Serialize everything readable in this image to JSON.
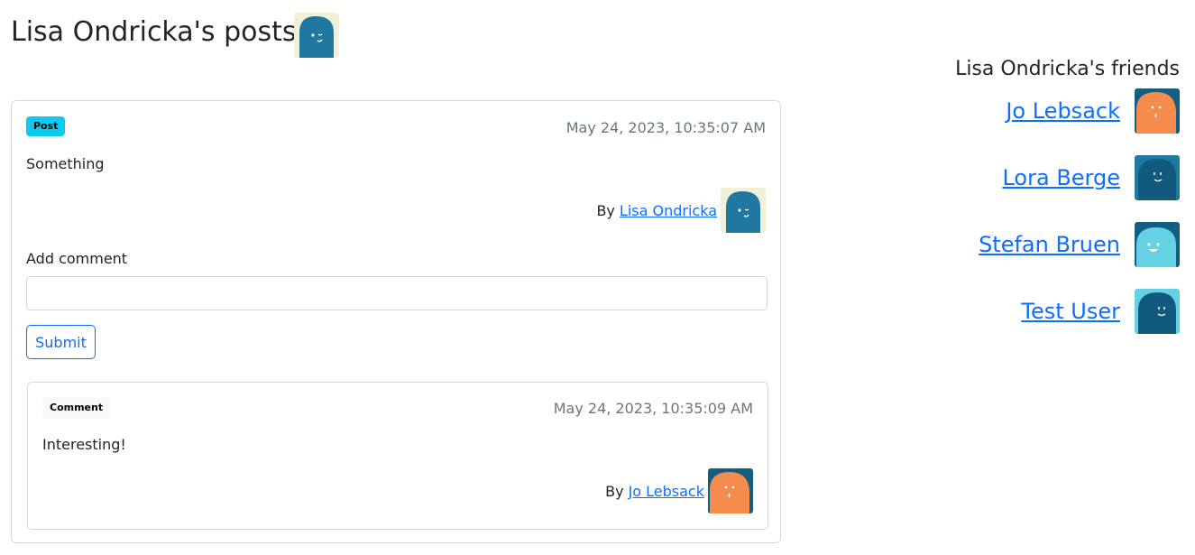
{
  "page": {
    "title": "Lisa Ondricka's posts"
  },
  "post": {
    "badge": "Post",
    "timestamp": "May 24, 2023, 10:35:07 AM",
    "text": "Something",
    "by_prefix": "By",
    "author": "Lisa Ondricka",
    "add_comment_label": "Add comment",
    "comment_input_value": "",
    "submit_label": "Submit"
  },
  "comment": {
    "badge": "Comment",
    "timestamp": "May 24, 2023, 10:35:09 AM",
    "text": "Interesting!",
    "by_prefix": "By",
    "author": "Jo Lebsack"
  },
  "friends": {
    "heading": "Lisa Ondricka's friends",
    "items": [
      {
        "name": "Jo Lebsack"
      },
      {
        "name": "Lora Berge"
      },
      {
        "name": "Stefan Bruen"
      },
      {
        "name": "Test User"
      }
    ]
  },
  "colors": {
    "link": "#0d6efd",
    "post_badge": "#0dcaf0",
    "comment_badge": "#f8f9fa",
    "muted_text": "#6c757d",
    "border": "#d6d8db"
  }
}
